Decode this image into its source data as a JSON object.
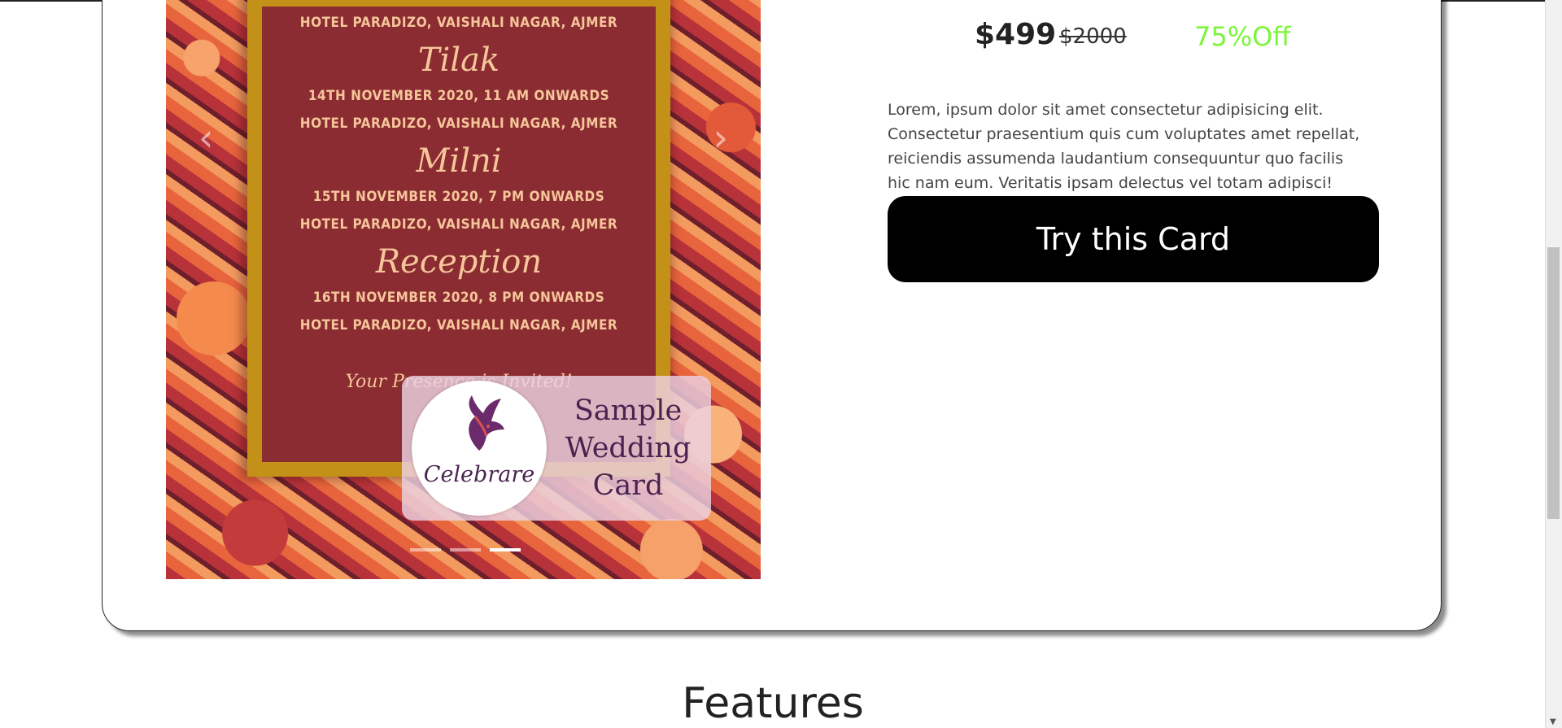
{
  "product": {
    "price_now": "$499",
    "price_old": "$2000",
    "discount": "75%Off",
    "description": "Lorem, ipsum dolor sit amet consectetur adipisicing elit. Consectetur praesentium quis cum voluptates amet repellat, reiciendis assumenda laudantium consequuntur quo facilis hic nam eum. Veritatis ipsam delectus vel totam adipisci!",
    "cta_label": "Try this Card"
  },
  "carousel": {
    "prev_icon": "chevron-left-icon",
    "next_icon": "chevron-right-icon",
    "slide_count": 3,
    "active_index": 2,
    "invite": {
      "venue_top": "HOTEL PARADIZO, VAISHALI NAGAR, AJMER",
      "events": [
        {
          "name": "Tilak",
          "date": "14TH NOVEMBER 2020, 11 AM ONWARDS",
          "venue": "HOTEL PARADIZO, VAISHALI NAGAR, AJMER"
        },
        {
          "name": "Milni",
          "date": "15TH NOVEMBER 2020, 7 PM ONWARDS",
          "venue": "HOTEL PARADIZO, VAISHALI NAGAR, AJMER"
        },
        {
          "name": "Reception",
          "date": "16TH NOVEMBER 2020, 8 PM ONWARDS",
          "venue": "HOTEL PARADIZO, VAISHALI NAGAR, AJMER"
        }
      ],
      "closing": "Your Presence is Invited!"
    },
    "watermark": {
      "brand": "Celebrare",
      "line1": "Sample",
      "line2": "Wedding",
      "line3": "Card"
    }
  },
  "sections": {
    "features_heading": "Features"
  },
  "colors": {
    "cta_bg": "#000000",
    "discount": "#7cf53a",
    "invite_bg": "#8a2c31",
    "invite_border": "#c39117"
  }
}
